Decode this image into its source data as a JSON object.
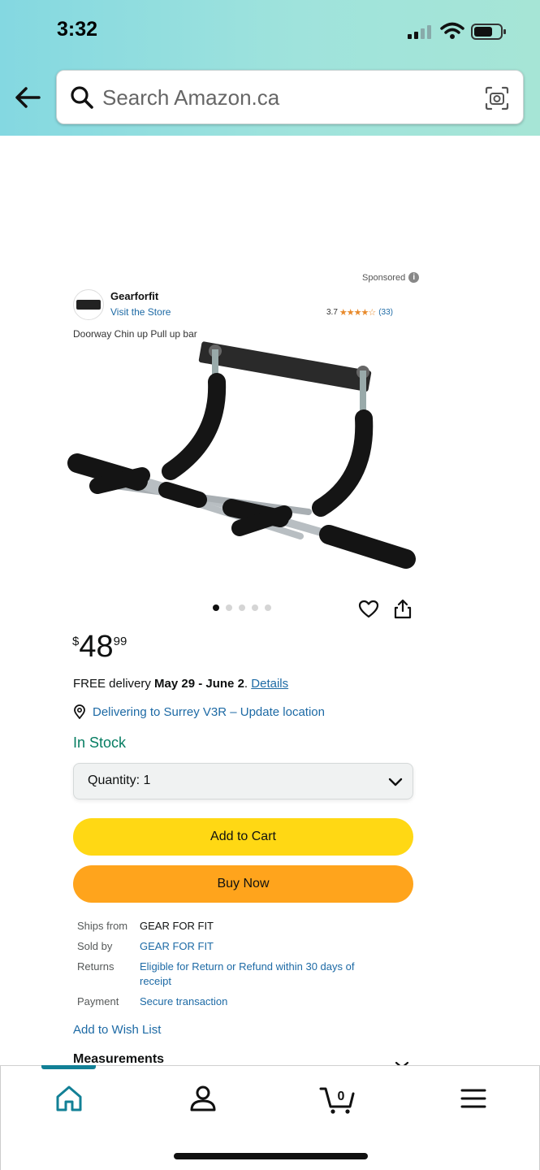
{
  "status_bar": {
    "time": "3:32"
  },
  "search": {
    "placeholder": "Search Amazon.ca"
  },
  "sponsored_ad": {
    "label": "Sponsored",
    "info": "i",
    "brand_name": "Gearforfit",
    "store_link": "Visit the Store",
    "rating_value": "3.7",
    "stars": "★★★★☆",
    "rating_count": "(33)",
    "title": "Doorway Chin up Pull up bar"
  },
  "carousel": {
    "dot_count": 5,
    "active_index": 0
  },
  "price": {
    "symbol": "$",
    "whole": "48",
    "fraction": "99"
  },
  "delivery": {
    "prefix": "FREE delivery ",
    "dates": "May 29 - June 2",
    "suffix": ". ",
    "details_link": "Details"
  },
  "location": {
    "text": "Delivering to Surrey V3R – Update location"
  },
  "stock": {
    "text": "In Stock"
  },
  "quantity": {
    "label": "Quantity: 1"
  },
  "buttons": {
    "add_to_cart": "Add to Cart",
    "buy_now": "Buy Now"
  },
  "info_rows": [
    {
      "key": "Ships from",
      "value": "GEAR FOR FIT"
    },
    {
      "key": "Sold by",
      "value": "GEAR FOR FIT"
    },
    {
      "key": "Returns",
      "value": "Eligible for Return or Refund within 30 days of receipt"
    },
    {
      "key": "Payment",
      "value": "Secure transaction"
    }
  ],
  "wishlist": {
    "label": "Add to Wish List"
  },
  "measurements": {
    "label": "Measurements"
  },
  "bottom_nav": {
    "items": [
      {
        "name": "home",
        "icon": "home-icon"
      },
      {
        "name": "account",
        "icon": "person-icon"
      },
      {
        "name": "cart",
        "icon": "cart-icon",
        "count": "0"
      },
      {
        "name": "menu",
        "icon": "menu-icon"
      }
    ]
  },
  "colors": {
    "header_gradient_start": "#84d8e1",
    "header_gradient_end": "#a6e5d6",
    "link": "#1d6aa5",
    "in_stock": "#067d62",
    "add_to_cart": "#ffd814",
    "buy_now": "#ffa41c",
    "nav_active": "#128096"
  }
}
